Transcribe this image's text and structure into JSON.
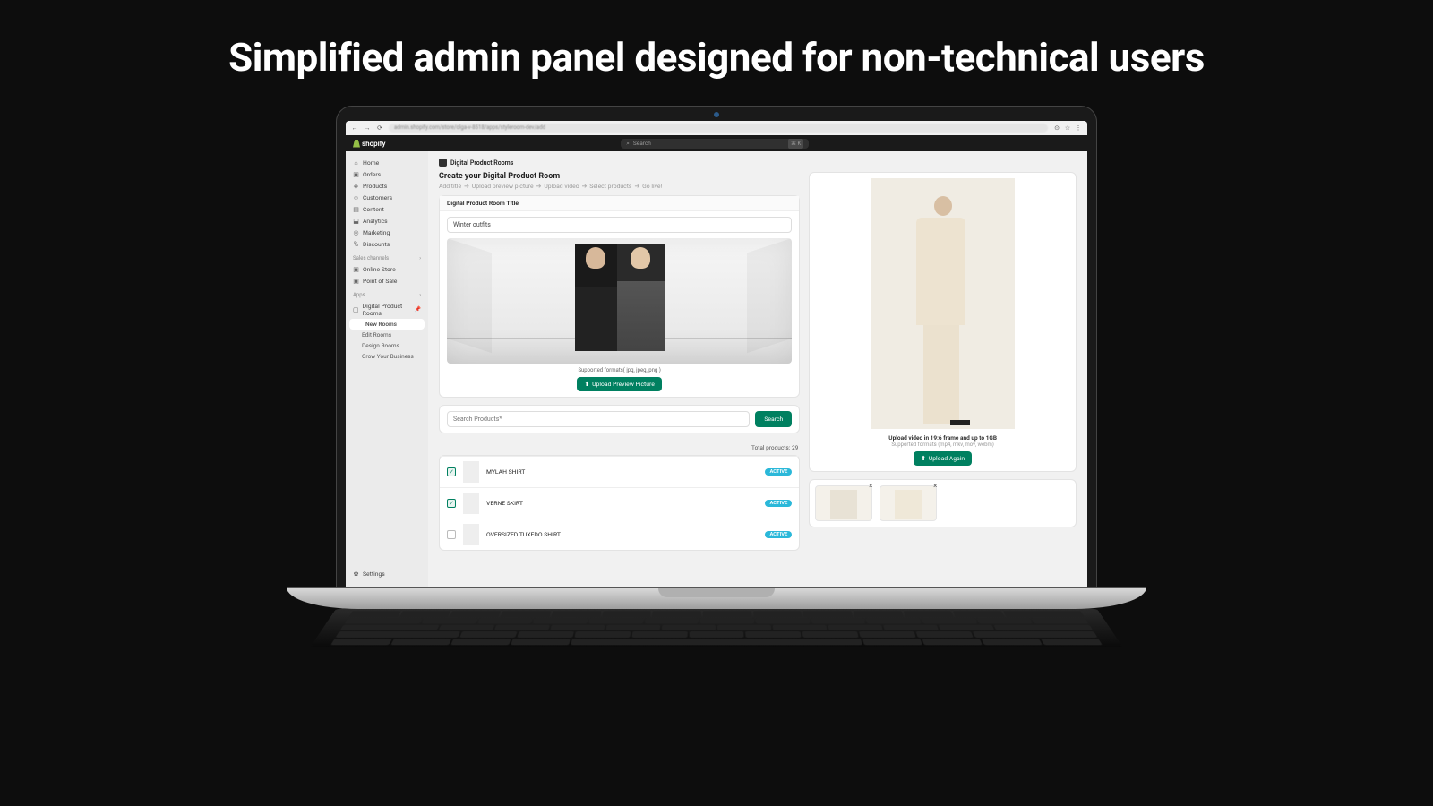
{
  "hero": "Simplified admin panel designed for non-technical users",
  "browser": {
    "url": "admin.shopify.com/store/olga-v-8518/apps/styleroom-dev/add",
    "search_placeholder": "Search",
    "kbd": "⌘ K",
    "brand": "shopify"
  },
  "sidebar": {
    "items": [
      {
        "icon": "⌂",
        "label": "Home"
      },
      {
        "icon": "▣",
        "label": "Orders"
      },
      {
        "icon": "◈",
        "label": "Products"
      },
      {
        "icon": "☺",
        "label": "Customers"
      },
      {
        "icon": "▤",
        "label": "Content"
      },
      {
        "icon": "⬓",
        "label": "Analytics"
      },
      {
        "icon": "◎",
        "label": "Marketing"
      },
      {
        "icon": "%",
        "label": "Discounts"
      }
    ],
    "channels_head": "Sales channels",
    "channels": [
      {
        "icon": "▣",
        "label": "Online Store"
      },
      {
        "icon": "▣",
        "label": "Point of Sale"
      }
    ],
    "apps_head": "Apps",
    "app": {
      "icon": "▢",
      "label": "Digital Product Rooms"
    },
    "app_sub": [
      {
        "label": "New Rooms",
        "selected": true
      },
      {
        "label": "Edit Rooms"
      },
      {
        "label": "Design Rooms"
      },
      {
        "label": "Grow Your Business"
      }
    ],
    "settings": "Settings"
  },
  "page": {
    "breadcrumb": "Digital Product Rooms",
    "title": "Create your Digital Product Room",
    "steps": [
      "Add title",
      "Upload preview picture",
      "Upload video",
      "Select products",
      "Go live!"
    ],
    "title_field_label": "Digital Product Room Title",
    "title_value": "Winter outfits",
    "preview_hint": "Supported formats( jpg, jpeg, png )",
    "upload_preview_btn": "Upload Preview Picture",
    "search_placeholder": "Search Products*",
    "search_btn": "Search",
    "total_label": "Total products:",
    "total_count": 29,
    "products": [
      {
        "name": "MYLAH SHIRT",
        "status": "ACTIVE",
        "checked": true
      },
      {
        "name": "VERNE SKIRT",
        "status": "ACTIVE",
        "checked": true
      },
      {
        "name": "OVERSIZED TUXEDO SHIRT",
        "status": "ACTIVE",
        "checked": false
      }
    ],
    "video_caption": "Upload video in 19:6 frame and up to 1GB",
    "video_hint": "Supported formats (mp4, mkv, mov, webm)",
    "upload_again_btn": "Upload Again"
  }
}
